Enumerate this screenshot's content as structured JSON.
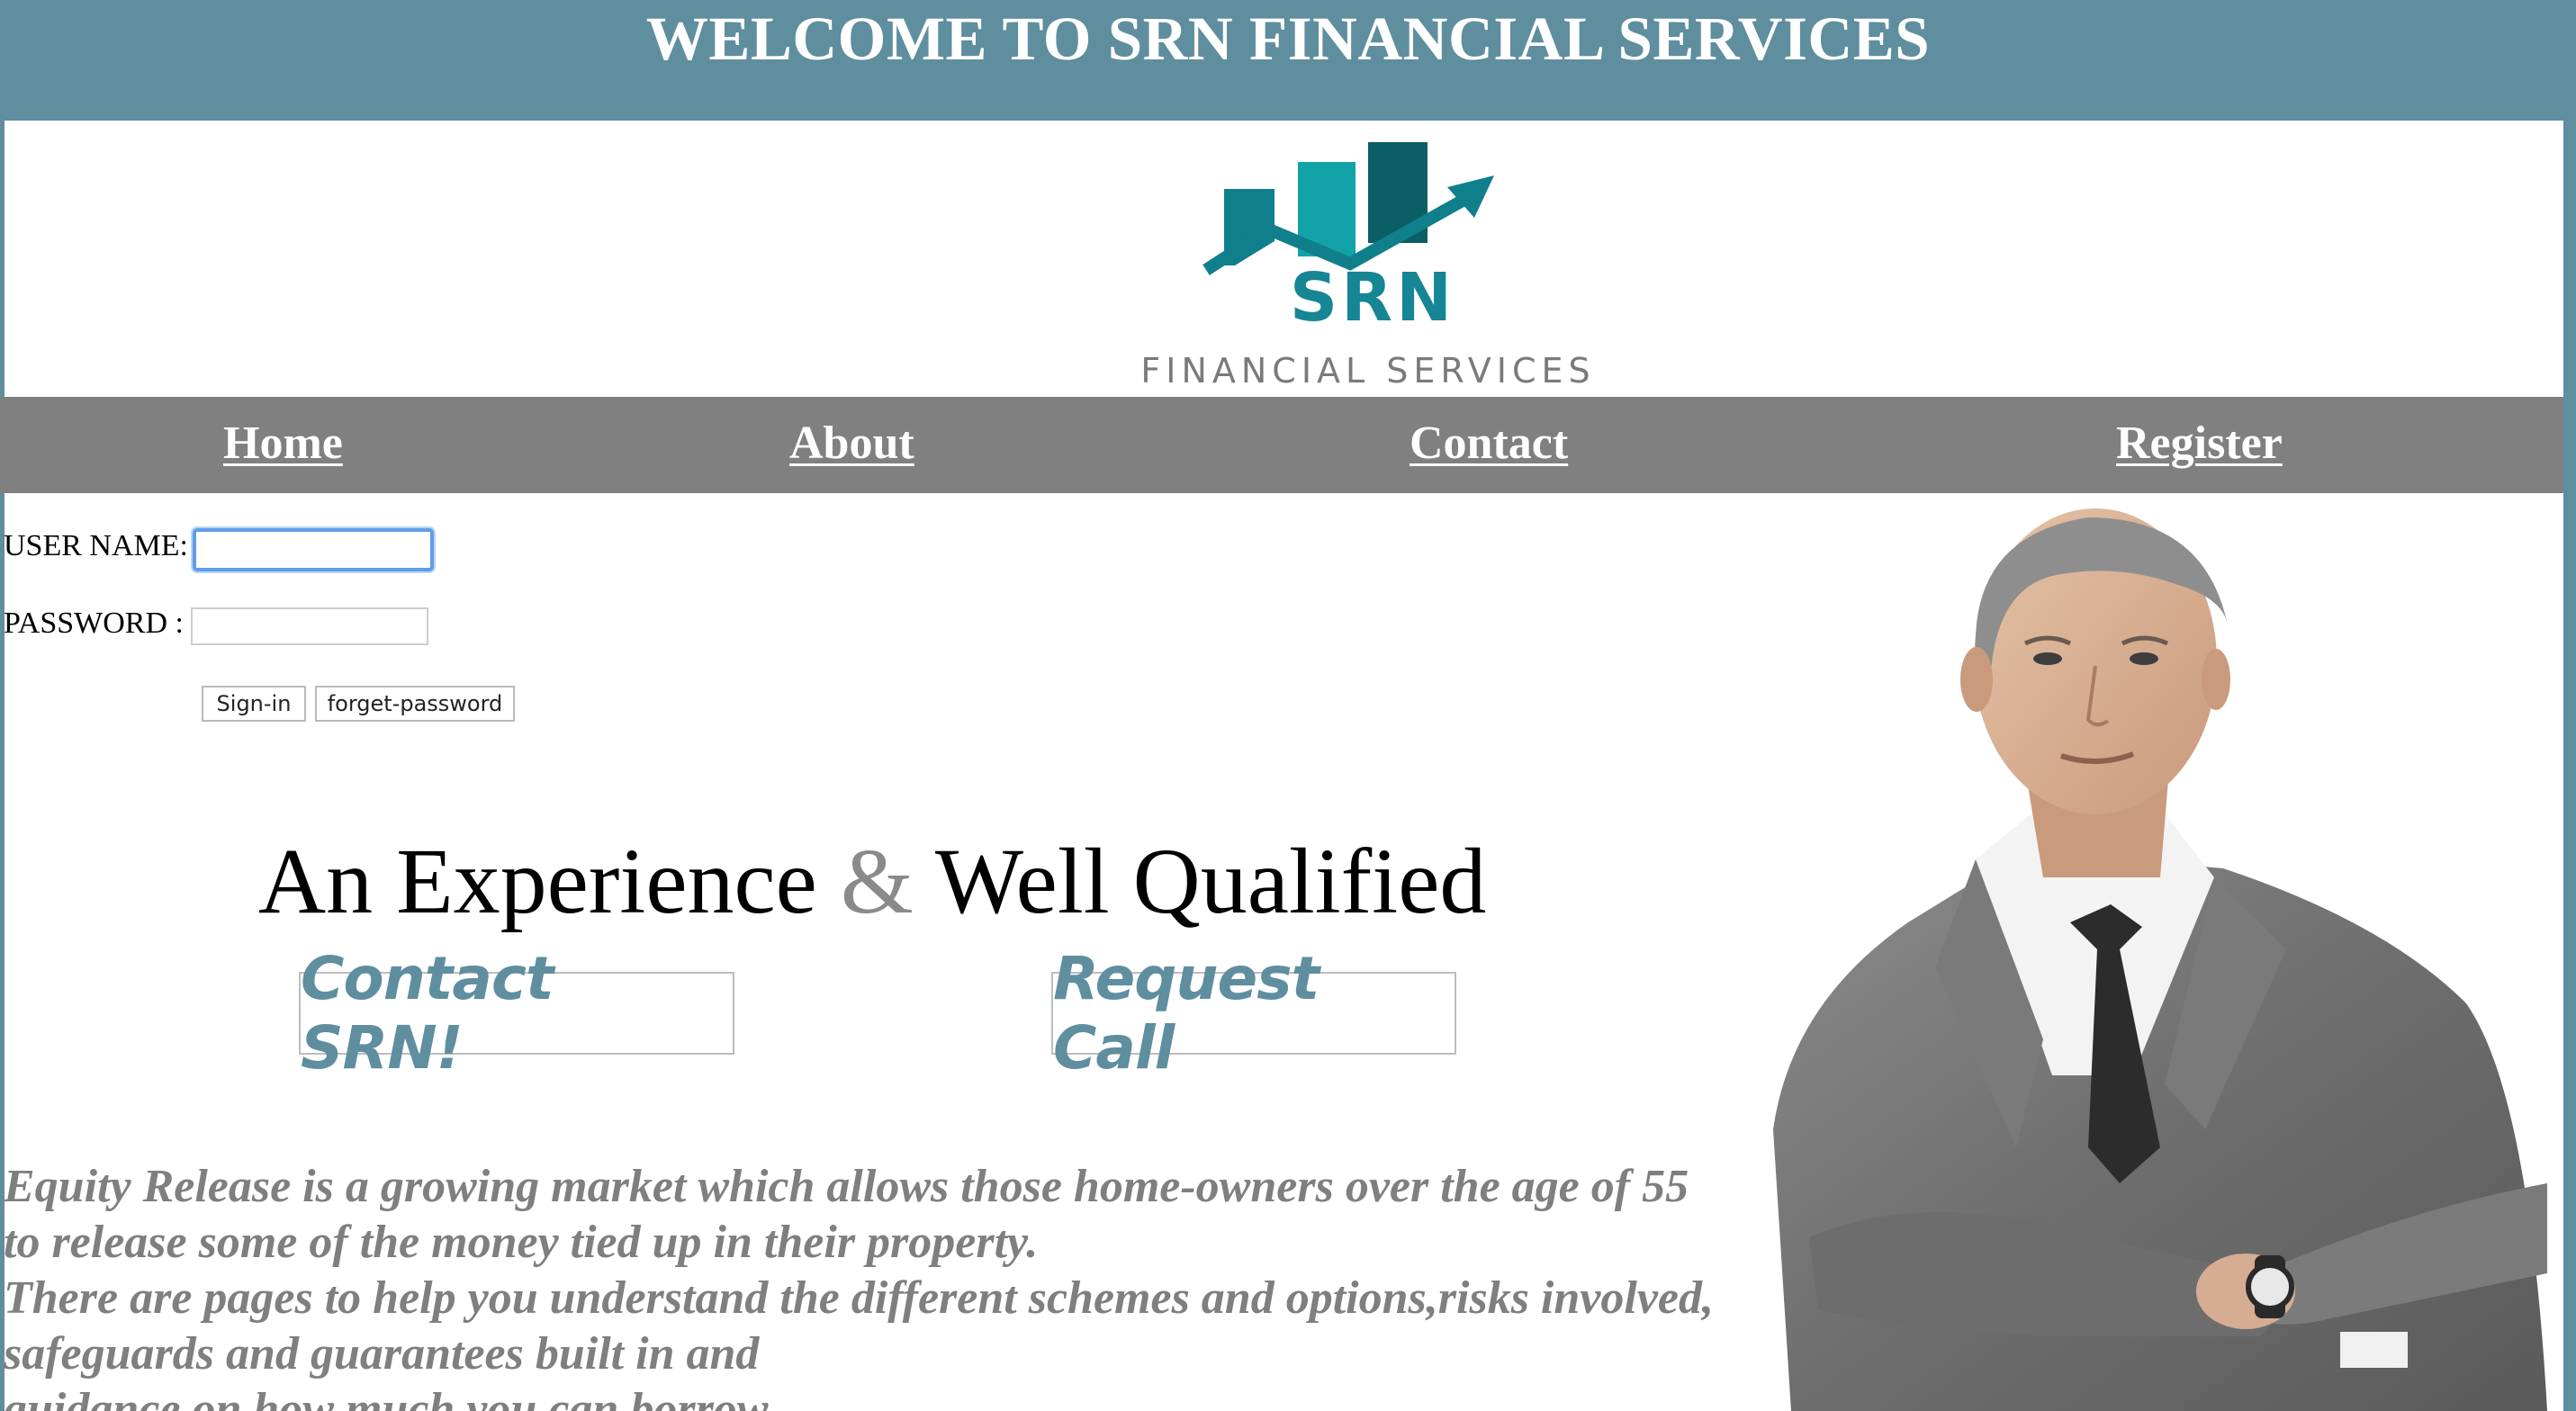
{
  "banner": {
    "title": "WELCOME TO SRN FINANCIAL SERVICES"
  },
  "logo": {
    "wordmark": "SRN",
    "subtitle": "FINANCIAL SERVICES",
    "icon": "bar-chart-arrow-icon"
  },
  "nav": {
    "items": [
      {
        "label": "Home"
      },
      {
        "label": "About"
      },
      {
        "label": "Contact"
      },
      {
        "label": "Register"
      }
    ]
  },
  "login": {
    "username_label": "USER NAME:",
    "username_value": "",
    "password_label": "PASSWORD :",
    "password_value": "",
    "signin_label": "Sign-in",
    "forgot_label": "forget-password"
  },
  "hero": {
    "tagline_part1": "An Experience ",
    "tagline_amp": "&",
    "tagline_part2": " Well Qualified",
    "contact_button": "Contact SRN!",
    "call_button": "Request Call"
  },
  "content": {
    "lines": [
      "Equity Release is a growing market which allows those home-owners over the age of 55",
      "to release some of the money tied up in their property.",
      "There are pages to help you understand the different schemes and options,risks involved,",
      "safeguards and guarantees built in and",
      "guidance on how much you can borrow."
    ]
  },
  "colors": {
    "banner": "#5f8e9f",
    "nav": "#808080",
    "cta_text": "#5f8e9f",
    "logo_teal": "#168594",
    "body_text": "#7f7f7f"
  }
}
